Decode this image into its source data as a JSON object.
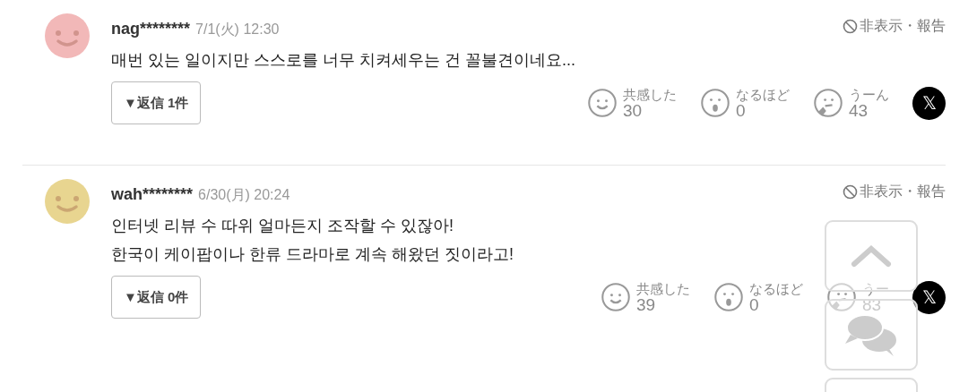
{
  "comments": [
    {
      "color": "#f2b8b8",
      "user": "nag********",
      "time": "7/1(火) 12:30",
      "hide_report": "非表示・報告",
      "body": [
        "매번 있는 일이지만 스스로를 너무 치켜세우는 건 꼴불견이네요..."
      ],
      "reply_button": "▼返信 1件",
      "reactions": [
        {
          "kind": "smile",
          "label": "共感した",
          "count": "30"
        },
        {
          "kind": "surprised",
          "label": "なるほど",
          "count": "0"
        },
        {
          "kind": "thinking",
          "label": "うーん",
          "count": "43"
        }
      ],
      "share": "𝕏"
    },
    {
      "color": "#e8d590",
      "user": "wah********",
      "time": "6/30(月) 20:24",
      "hide_report": "非表示・報告",
      "body": [
        "인터넷 리뷰 수 따위 얼마든지 조작할 수 있잖아!",
        "한국이 케이팝이나 한류 드라마로 계속 해왔던 짓이라고!"
      ],
      "reply_button": "▼返信 0件",
      "reactions": [
        {
          "kind": "smile",
          "label": "共感した",
          "count": "39"
        },
        {
          "kind": "surprised",
          "label": "なるほど",
          "count": "0"
        },
        {
          "kind": "thinking",
          "label": "うー",
          "count": "83"
        }
      ],
      "share": "𝕏"
    }
  ],
  "side_buttons": [
    {
      "kind": "top"
    },
    {
      "kind": "comments"
    },
    {
      "kind": "blank"
    }
  ]
}
